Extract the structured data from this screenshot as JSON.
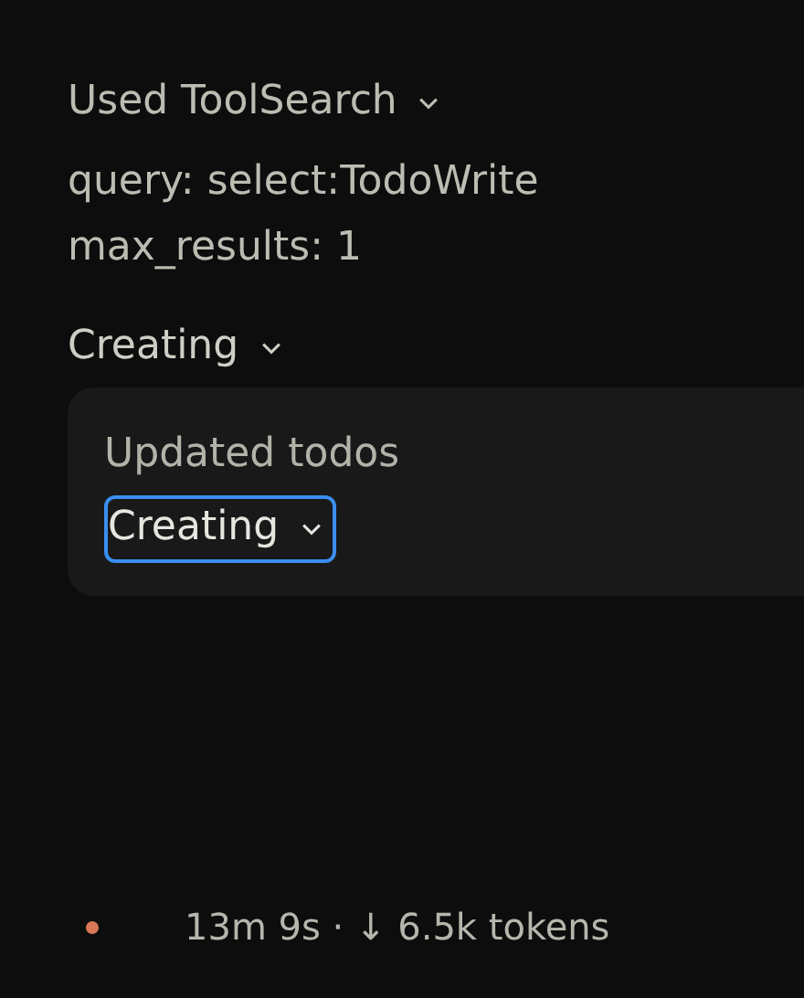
{
  "tool_use": {
    "title": "Used ToolSearch",
    "expanded": true,
    "params": [
      "query: select:TodoWrite",
      "max_results: 1"
    ]
  },
  "section": {
    "title": "Creating",
    "expanded": true,
    "card": {
      "label": "Updated todos",
      "button": {
        "label": "Creating",
        "focused": true
      }
    }
  },
  "status": {
    "text": "13m 9s · ↓ 6.5k tokens"
  }
}
